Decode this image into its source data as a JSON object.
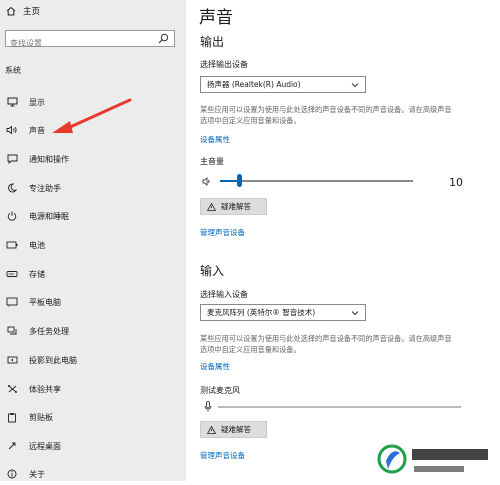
{
  "sidebar": {
    "home_label": "主页",
    "search_placeholder": "查找设置",
    "section": "系统",
    "items": [
      {
        "label": "显示"
      },
      {
        "label": "声音"
      },
      {
        "label": "通知和操作"
      },
      {
        "label": "专注助手"
      },
      {
        "label": "电源和睡眠"
      },
      {
        "label": "电池"
      },
      {
        "label": "存储"
      },
      {
        "label": "平板电脑"
      },
      {
        "label": "多任务处理"
      },
      {
        "label": "投影到此电脑"
      },
      {
        "label": "体验共享"
      },
      {
        "label": "剪贴板"
      },
      {
        "label": "远程桌面"
      },
      {
        "label": "关于"
      }
    ]
  },
  "main": {
    "title": "声音",
    "output": {
      "heading": "输出",
      "device_label": "选择输出设备",
      "device_value": "扬声器 (Realtek(R) Audio)",
      "desc": "某些应用可以设置为使用与此处选择的声音设备不同的声音设备。请在高级声音选项中自定义应用音量和设备。",
      "properties_link": "设备属性",
      "volume_label": "主音量",
      "volume_value": "10",
      "volume_fraction": 0.1,
      "troubleshoot": "疑难解答",
      "manage_link": "管理声音设备"
    },
    "input": {
      "heading": "输入",
      "device_label": "选择输入设备",
      "device_value": "麦克风阵列 (英特尔® 智音技术)",
      "desc": "某些应用可以设置为使用与此处选择的声音设备不同的声音设备。请在高级声音选项中自定义应用音量和设备。",
      "properties_link": "设备属性",
      "test_label": "测试麦克风",
      "troubleshoot": "疑难解答",
      "manage_link": "管理声音设备"
    }
  },
  "colors": {
    "accent": "#0067b8",
    "arrow": "#e8392c",
    "sidebar_bg": "#ececec"
  }
}
